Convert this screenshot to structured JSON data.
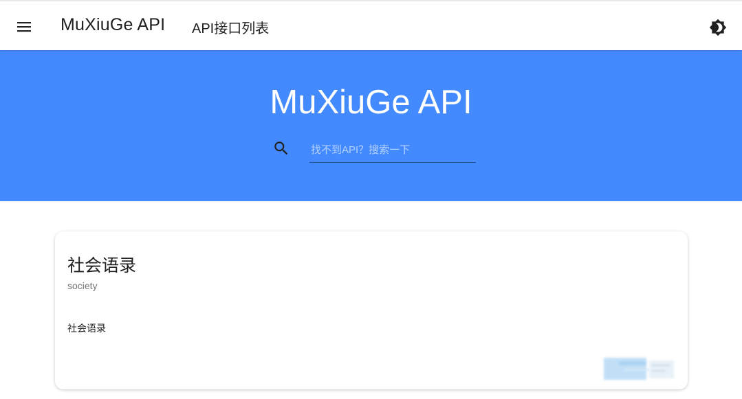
{
  "header": {
    "menu_icon": "menu-icon",
    "app_title": "MuXiuGe API",
    "nav_link": "API接口列表",
    "theme_icon": "brightness-icon"
  },
  "hero": {
    "title": "MuXiuGe API",
    "search": {
      "icon": "search-icon",
      "placeholder": "找不到API？搜索一下",
      "value": ""
    },
    "background": "#448aff"
  },
  "cards": [
    {
      "title": "社会语录",
      "subtitle": "society",
      "description": "社会语录"
    }
  ],
  "colors": {
    "primary": "#448aff",
    "surface": "#ffffff",
    "text": "#212121",
    "muted": "#757575"
  }
}
